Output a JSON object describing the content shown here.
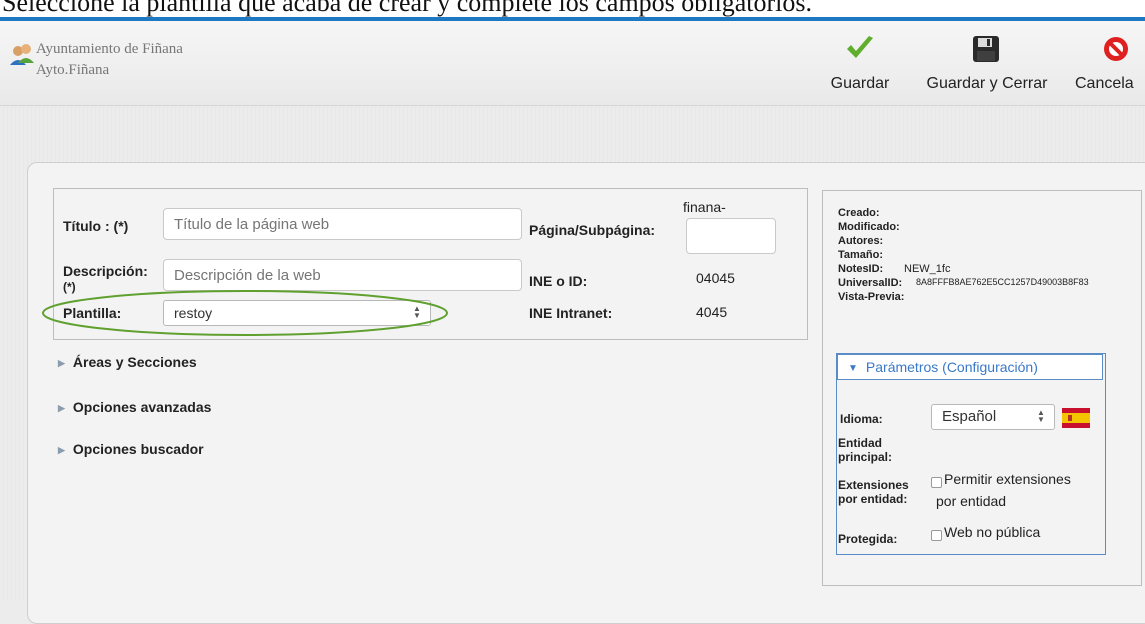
{
  "instruction_banner": "Seleccione la plantilla que acaba de crear y complete los campos obligatorios.",
  "header": {
    "org_name": "Ayuntamiento de Fiñana",
    "org_short": "Ayto.Fiñana",
    "buttons": {
      "save": "Guardar",
      "save_close": "Guardar y Cerrar",
      "cancel": "Cancela"
    }
  },
  "form": {
    "title_label": "Título : (*)",
    "title_placeholder": "Título de la página web",
    "description_label_1": "Descripción:",
    "description_label_2": "(*)",
    "description_placeholder": "Descripción de la web",
    "template_label": "Plantilla:",
    "template_value": "restoy",
    "page_label": "Página/Subpágina:",
    "page_prefix": "finana-",
    "page_value": "",
    "ine_label": "INE o ID:",
    "ine_value": "04045",
    "ine_intranet_label": "INE Intranet:",
    "ine_intranet_value": "4045"
  },
  "sections": [
    "Áreas y Secciones",
    "Opciones avanzadas",
    "Opciones buscador"
  ],
  "meta": {
    "created_label": "Creado:",
    "modified_label": "Modificado:",
    "authors_label": "Autores:",
    "size_label": "Tamaño:",
    "notesid_label": "NotesID:",
    "notesid_value": "NEW_1fc",
    "universalid_label": "UniversalID:",
    "universalid_value": "8A8FFFB8AE762E5CC1257D49003B8F83",
    "preview_label": "Vista-Previa:"
  },
  "params": {
    "header": "Parámetros (Configuración)",
    "language_label": "Idioma:",
    "language_value": "Español",
    "entity_label_1": "Entidad",
    "entity_label_2": "principal:",
    "ext_label_1": "Extensiones",
    "ext_label_2": "por entidad:",
    "ext_text_1": "Permitir extensiones",
    "ext_text_2": "por entidad",
    "protected_label": "Protegida:",
    "protected_text": "Web no pública"
  },
  "colors": {
    "accent_bar": "#1f78c2",
    "highlight_ellipse": "#5fa02f",
    "param_header": "#3a79c9"
  },
  "icons": [
    "user-group-icon",
    "checkmark-icon",
    "floppy-disk-icon",
    "cancel-icon",
    "triangle-right-icon",
    "triangle-down-icon",
    "spain-flag-icon",
    "select-stepper-icon"
  ]
}
